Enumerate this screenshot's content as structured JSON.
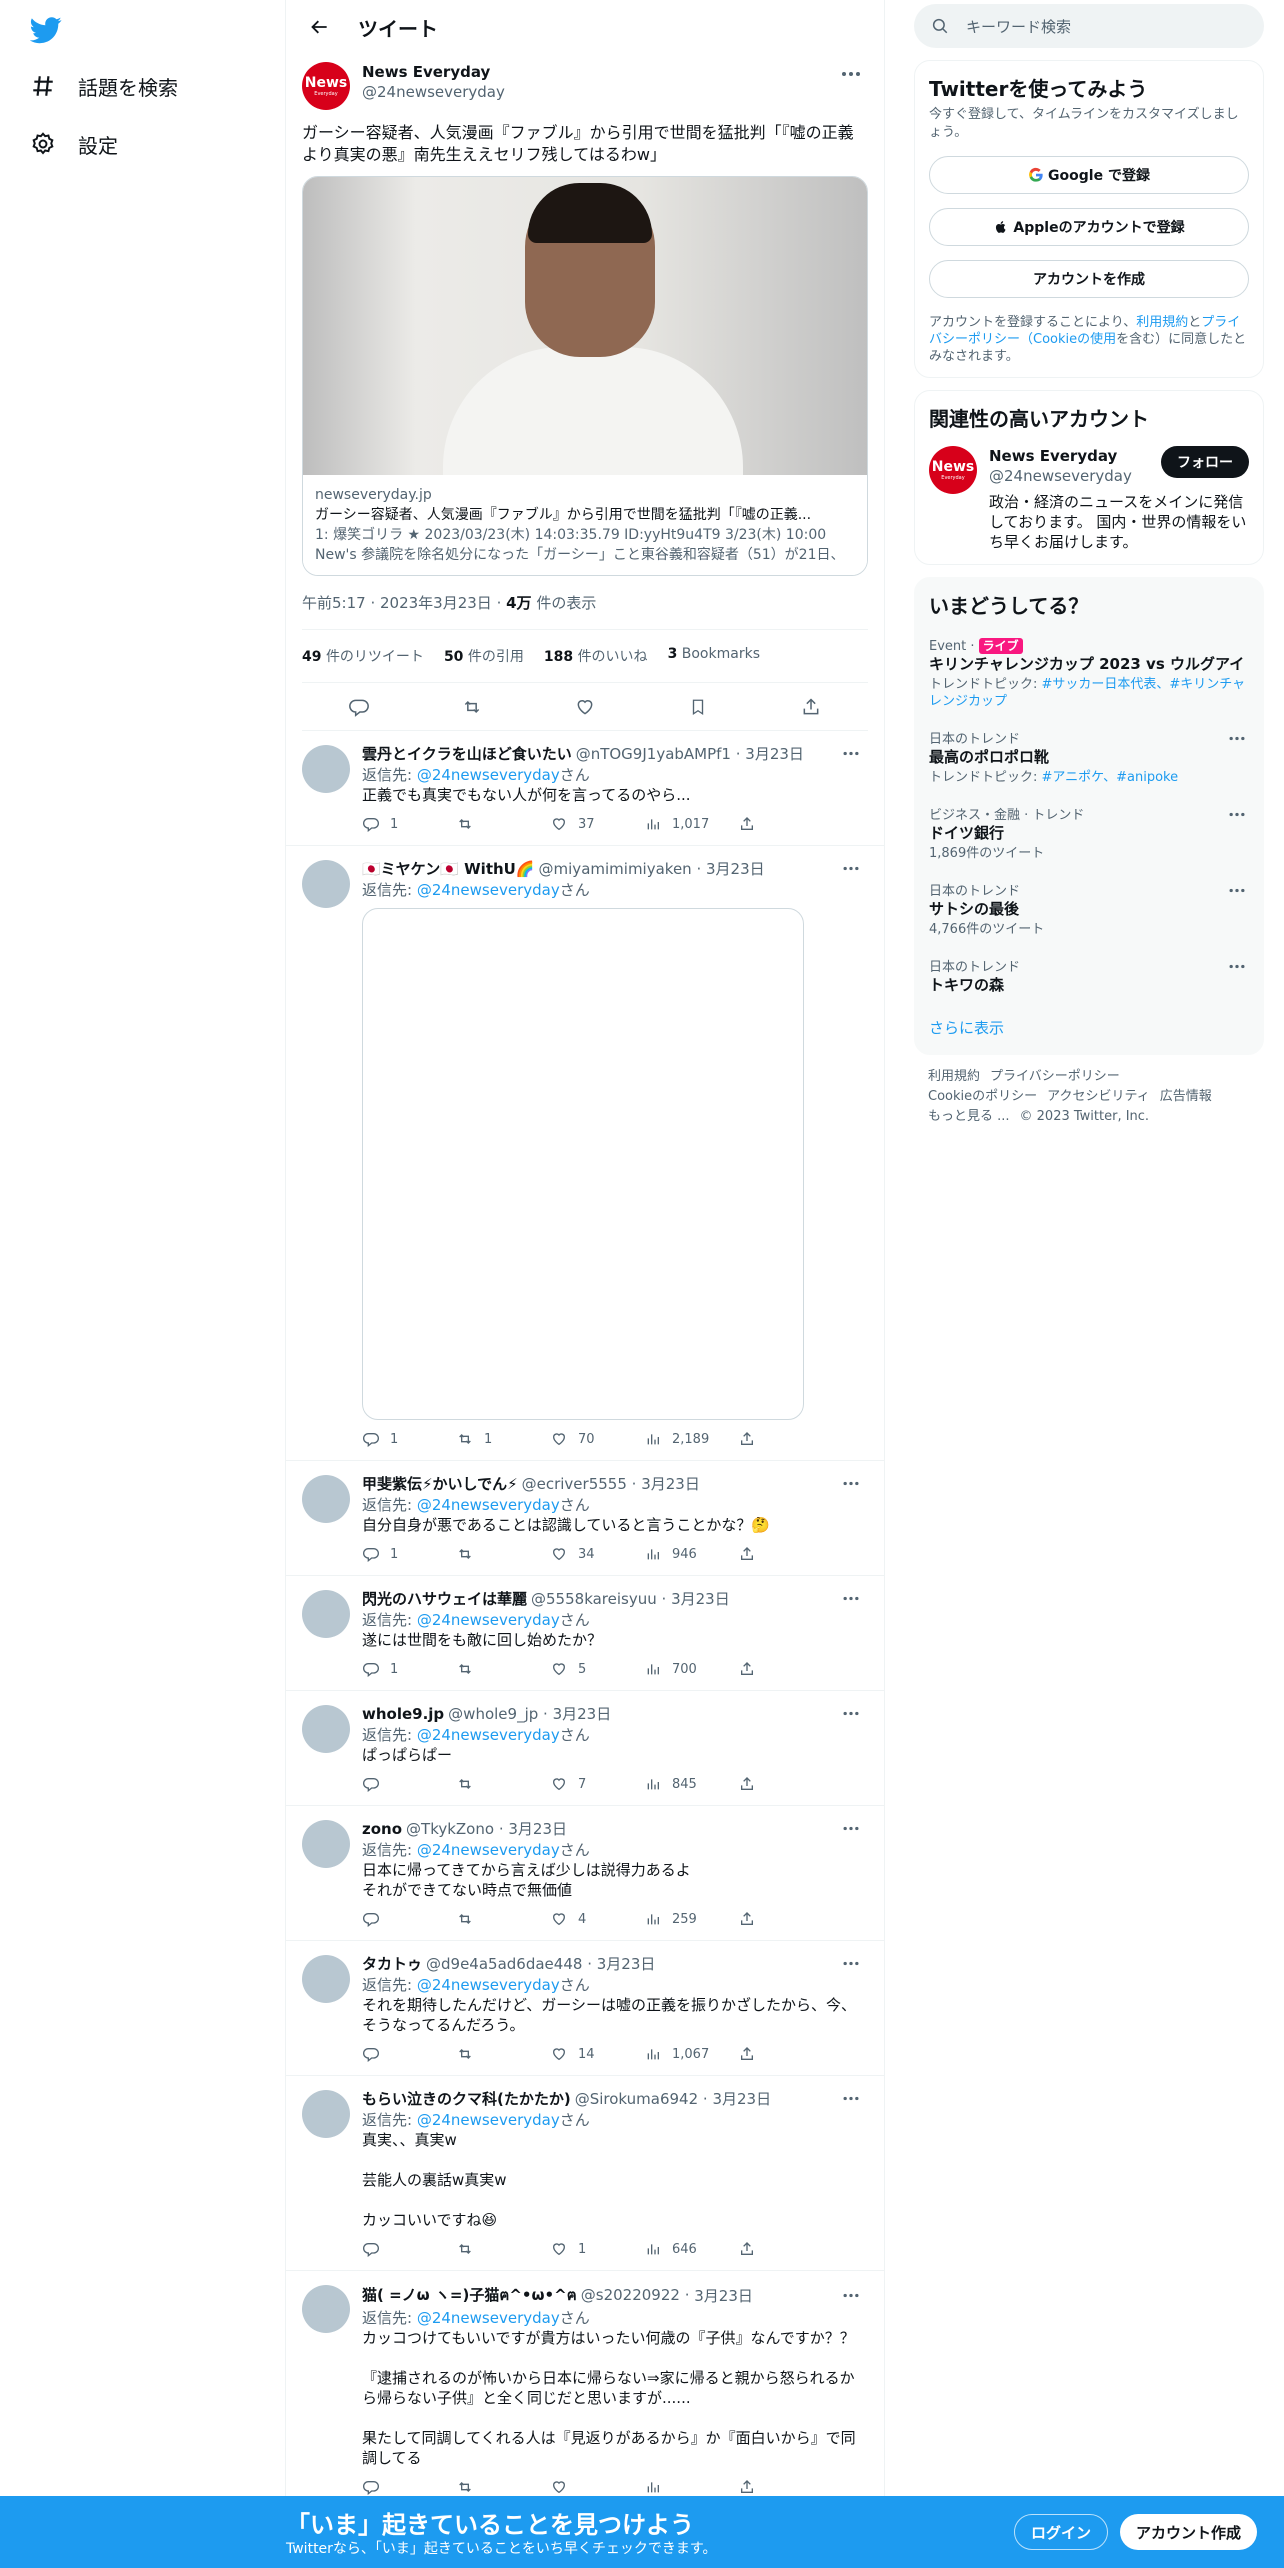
{
  "nav": {
    "items": [
      {
        "label": "話題を検索",
        "icon": "hash-icon"
      },
      {
        "label": "設定",
        "icon": "gear-icon"
      }
    ]
  },
  "header": {
    "title": "ツイート"
  },
  "tweet": {
    "author_name": "News Everyday",
    "author_handle": "@24newseveryday",
    "avatar_text": "News",
    "avatar_sub": "Everyday",
    "text": "ガーシー容疑者、人気漫画『ファブル』から引用で世間を猛批判「『嘘の正義より真実の悪』南先生ええセリフ残してはるわw」",
    "card": {
      "domain": "newseveryday.jp",
      "title": "ガーシー容疑者、人気漫画『ファブル』から引用で世間を猛批判「『嘘の正義...",
      "desc": "1: 爆笑ゴリラ ★ 2023/03/23(木) 14:03:35.79 ID:yyHt9u4T9 3/23(木) 10:00 New's 参議院を除名処分になった「ガーシー」こと東谷義和容疑者（51）が21日、自..."
    },
    "time": "午前5:17",
    "date": "2023年3月23日",
    "views_num": "4万",
    "views_label": "件の表示",
    "retweets_num": "49",
    "retweets_label": "件のリツイート",
    "quotes_num": "50",
    "quotes_label": "件の引用",
    "likes_num": "188",
    "likes_label": "件のいいね",
    "bookmarks_num": "3",
    "bookmarks_label": "Bookmarks"
  },
  "replies": [
    {
      "name": "雲丹とイクラを山ほど食いたい",
      "handle": "@nTOG9J1yabAMPf1",
      "date": "3月23日",
      "reply_to": "@24newseveryday",
      "san": "さん",
      "text": "正義でも真実でもない人が何を言ってるのやら...",
      "replies": "1",
      "retweets": "",
      "likes": "37",
      "views": "1,017"
    },
    {
      "name": "🇯🇵ミヤケン🇯🇵 WithU🌈",
      "handle": "@miyamimimiyaken",
      "date": "3月23日",
      "reply_to": "@24newseveryday",
      "san": "さん",
      "text": "",
      "media": true,
      "replies": "1",
      "retweets": "1",
      "likes": "70",
      "views": "2,189"
    },
    {
      "name": "甲斐紫伝⚡かいしでん⚡",
      "handle": "@ecriver5555",
      "date": "3月23日",
      "reply_to": "@24newseveryday",
      "san": "さん",
      "text": "自分自身が悪であることは認識していると言うことかな？🤔",
      "replies": "1",
      "retweets": "",
      "likes": "34",
      "views": "946"
    },
    {
      "name": "閃光のハサウェイは華麗",
      "handle": "@5558kareisyuu",
      "date": "3月23日",
      "reply_to": "@24newseveryday",
      "san": "さん",
      "text": "遂には世間をも敵に回し始めたか？",
      "replies": "1",
      "retweets": "",
      "likes": "5",
      "views": "700"
    },
    {
      "name": "whole9.jp",
      "handle": "@whole9_jp",
      "date": "3月23日",
      "reply_to": "@24newseveryday",
      "san": "さん",
      "text": "ぱっぱらぱー",
      "replies": "",
      "retweets": "",
      "likes": "7",
      "views": "845"
    },
    {
      "name": "zono",
      "handle": "@TkykZono",
      "date": "3月23日",
      "reply_to": "@24newseveryday",
      "san": "さん",
      "text": "日本に帰ってきてから言えば少しは説得力あるよ\nそれができてない時点で無価値",
      "replies": "",
      "retweets": "",
      "likes": "4",
      "views": "259"
    },
    {
      "name": "タカトゥ",
      "handle": "@d9e4a5ad6dae448",
      "date": "3月23日",
      "reply_to": "@24newseveryday",
      "san": "さん",
      "text": "それを期待したんだけど、ガーシーは嘘の正義を振りかざしたから、今、そうなってるんだろう。",
      "replies": "",
      "retweets": "",
      "likes": "14",
      "views": "1,067"
    },
    {
      "name": "もらい泣きのクマ科(たかたか)",
      "handle": "@Sirokuma6942",
      "date": "3月23日",
      "reply_to": "@24newseveryday",
      "san": "さん",
      "text": "真実、、真実w\n\n芸能人の裏話w真実w\n\nカッコいいですね😆",
      "replies": "",
      "retweets": "",
      "likes": "1",
      "views": "646"
    },
    {
      "name": "猫( =ノω ヽ=)子猫ฅ^•ω•^ฅ",
      "handle": "@s20220922",
      "date": "3月23日",
      "reply_to": "@24newseveryday",
      "san": "さん",
      "text": "カッコつけてもいいですが貴方はいったい何歳の『子供』なんですか？？\n\n『逮捕されるのが怖いから日本に帰らない⇒家に帰ると親から怒られるから帰らない子供』と全く同じだと思いますが......\n\n果たして同調してくれる人は『見返りがあるから』か『面白いから』で同調してる",
      "replies": "",
      "retweets": "",
      "likes": "",
      "views": ""
    }
  ],
  "search": {
    "placeholder": "キーワード検索"
  },
  "signup_box": {
    "title": "Twitterを使ってみよう",
    "subtitle": "今すぐ登録して、タイムラインをカスタマイズしましょう。",
    "google": "Google で登録",
    "apple": "Appleのアカウントで登録",
    "create": "アカウントを作成",
    "terms_pre": "アカウントを登録することにより、",
    "terms_link1": "利用規約",
    "terms_and": "と",
    "terms_link2": "プライバシーポリシー（Cookieの使用",
    "terms_post": "を含む）に同意したとみなされます。"
  },
  "related": {
    "title": "関連性の高いアカウント",
    "name": "News Everyday",
    "handle": "@24newseveryday",
    "follow": "フォロー",
    "bio": "政治・経済のニュースをメインに発信しております。 国内・世界の情報をいち早くお届けします。"
  },
  "trends": {
    "title": "いまどうしてる？",
    "items": [
      {
        "context": "Event ·",
        "live": "ライブ",
        "title": "キリンチャレンジカップ 2023 vs ウルグアイ",
        "topic_pre": "トレンドトピック: ",
        "topics": "#サッカー日本代表、#キリンチャレンジカップ",
        "more": false
      },
      {
        "context": "日本のトレンド",
        "title": "最高のポロポロ靴",
        "topic_pre": "トレンドトピック: ",
        "topics": "#アニポケ、#anipoke",
        "more": true
      },
      {
        "context": "ビジネス・金融 · トレンド",
        "title": "ドイツ銀行",
        "count": "1,869件のツイート",
        "more": true
      },
      {
        "context": "日本のトレンド",
        "title": "サトシの最後",
        "count": "4,766件のツイート",
        "more": true
      },
      {
        "context": "日本のトレンド",
        "title": "トキワの森",
        "more": true
      }
    ],
    "show_more": "さらに表示"
  },
  "footer": {
    "links": [
      "利用規約",
      "プライバシーポリシー",
      "Cookieのポリシー",
      "アクセシビリティ",
      "広告情報",
      "もっと見る ..."
    ],
    "copyright": "© 2023 Twitter, Inc."
  },
  "bottom_bar": {
    "headline": "「いま」起きていることを見つけよう",
    "sub": "Twitterなら、「いま」起きていることをいち早くチェックできます。",
    "login": "ログイン",
    "signup": "アカウント作成"
  },
  "colors": {
    "accent": "#1d9bf0",
    "live": "#f91880",
    "avatar_red": "#d7001a"
  }
}
